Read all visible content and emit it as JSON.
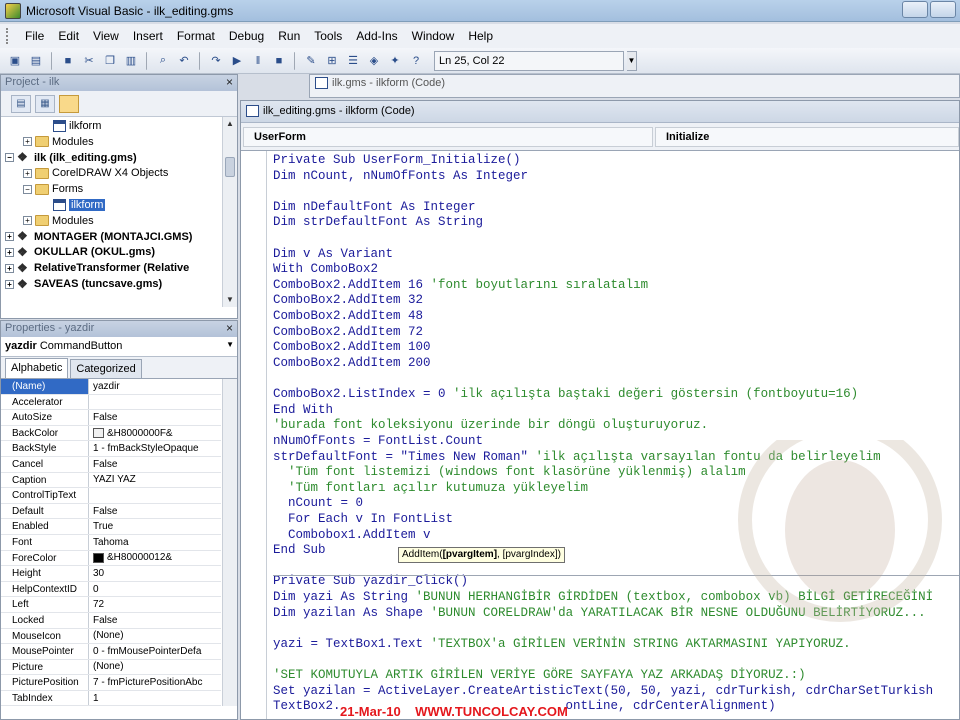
{
  "window": {
    "title": "Microsoft Visual Basic - ilk_editing.gms"
  },
  "menu": [
    "File",
    "Edit",
    "View",
    "Insert",
    "Format",
    "Debug",
    "Run",
    "Tools",
    "Add-Ins",
    "Window",
    "Help"
  ],
  "toolbar": {
    "buttons": [
      "view-host-icon",
      "insert-userform-icon",
      "save-icon",
      "cut-icon",
      "copy-icon",
      "paste-icon",
      "find-icon",
      "undo-icon",
      "redo-icon",
      "run-icon",
      "break-icon",
      "reset-icon",
      "design-mode-icon",
      "project-explorer-icon",
      "properties-window-icon",
      "object-browser-icon",
      "toolbox-icon",
      "help-icon"
    ],
    "position": "Ln 25, Col 22"
  },
  "project": {
    "title": "Project - ilk",
    "close": "×",
    "tree": [
      {
        "label": "ilkform",
        "icon": "form",
        "indent": 3,
        "bold": false,
        "expander": ""
      },
      {
        "label": "Modules",
        "icon": "folder",
        "indent": 2,
        "bold": false,
        "expander": "+"
      },
      {
        "label": "ilk (ilk_editing.gms)",
        "icon": "project",
        "indent": 1,
        "bold": true,
        "expander": "−"
      },
      {
        "label": "CorelDRAW X4 Objects",
        "icon": "folder",
        "indent": 2,
        "bold": false,
        "expander": "+"
      },
      {
        "label": "Forms",
        "icon": "folder",
        "indent": 2,
        "bold": false,
        "expander": "−"
      },
      {
        "label": "ilkform",
        "icon": "form",
        "indent": 3,
        "bold": false,
        "expander": "",
        "selected": true
      },
      {
        "label": "Modules",
        "icon": "folder",
        "indent": 2,
        "bold": false,
        "expander": "+"
      },
      {
        "label": "MONTAGER (MONTAJCI.GMS)",
        "icon": "project",
        "indent": 1,
        "bold": true,
        "expander": "+"
      },
      {
        "label": "OKULLAR (OKUL.gms)",
        "icon": "project",
        "indent": 1,
        "bold": true,
        "expander": "+"
      },
      {
        "label": "RelativeTransformer (Relative",
        "icon": "project",
        "indent": 1,
        "bold": true,
        "expander": "+"
      },
      {
        "label": "SAVEAS (tuncsave.gms)",
        "icon": "project",
        "indent": 1,
        "bold": true,
        "expander": "+"
      }
    ]
  },
  "properties": {
    "title": "Properties - yazdir",
    "close": "×",
    "object_name": "yazdir",
    "object_type": "CommandButton",
    "tabs": [
      "Alphabetic",
      "Categorized"
    ],
    "rows": [
      {
        "name": "(Name)",
        "value": "yazdir",
        "selected": true
      },
      {
        "name": "Accelerator",
        "value": ""
      },
      {
        "name": "AutoSize",
        "value": "False"
      },
      {
        "name": "BackColor",
        "value": "&H8000000F&",
        "swatch": "#f0f0f0"
      },
      {
        "name": "BackStyle",
        "value": "1 - fmBackStyleOpaque"
      },
      {
        "name": "Cancel",
        "value": "False"
      },
      {
        "name": "Caption",
        "value": "YAZI YAZ"
      },
      {
        "name": "ControlTipText",
        "value": ""
      },
      {
        "name": "Default",
        "value": "False"
      },
      {
        "name": "Enabled",
        "value": "True"
      },
      {
        "name": "Font",
        "value": "Tahoma"
      },
      {
        "name": "ForeColor",
        "value": "&H80000012&",
        "swatch": "#000000"
      },
      {
        "name": "Height",
        "value": "30"
      },
      {
        "name": "HelpContextID",
        "value": "0"
      },
      {
        "name": "Left",
        "value": "72"
      },
      {
        "name": "Locked",
        "value": "False"
      },
      {
        "name": "MouseIcon",
        "value": "(None)"
      },
      {
        "name": "MousePointer",
        "value": "0 - fmMousePointerDefa"
      },
      {
        "name": "Picture",
        "value": "(None)"
      },
      {
        "name": "PicturePosition",
        "value": "7 - fmPicturePositionAbc"
      },
      {
        "name": "TabIndex",
        "value": "1"
      }
    ]
  },
  "back_window": {
    "caption": "ilk.gms - ilkform (Code)"
  },
  "code_window": {
    "caption": "ilk_editing.gms - ilkform (Code)",
    "object_combo": "UserForm",
    "procedure_combo": "Initialize",
    "lines": [
      [
        [
          "kw",
          "Private Sub "
        ],
        [
          "tx",
          "UserForm_Initialize()"
        ]
      ],
      [
        [
          "kw",
          "Dim "
        ],
        [
          "tx",
          "nCount, nNumOfFonts "
        ],
        [
          "kw",
          "As Integer"
        ]
      ],
      [],
      [
        [
          "kw",
          "Dim "
        ],
        [
          "tx",
          "nDefaultFont "
        ],
        [
          "kw",
          "As Integer"
        ]
      ],
      [
        [
          "kw",
          "Dim "
        ],
        [
          "tx",
          "strDefaultFont "
        ],
        [
          "kw",
          "As String"
        ]
      ],
      [],
      [
        [
          "kw",
          "Dim "
        ],
        [
          "tx",
          "v "
        ],
        [
          "kw",
          "As Variant"
        ]
      ],
      [
        [
          "kw",
          "With "
        ],
        [
          "tx",
          "ComboBox2"
        ]
      ],
      [
        [
          "tx",
          "ComboBox2.AddItem 16 "
        ],
        [
          "cm",
          "'font boyutlarını sıralatalım"
        ]
      ],
      [
        [
          "tx",
          "ComboBox2.AddItem 32"
        ]
      ],
      [
        [
          "tx",
          "ComboBox2.AddItem 48"
        ]
      ],
      [
        [
          "tx",
          "ComboBox2.AddItem 72"
        ]
      ],
      [
        [
          "tx",
          "ComboBox2.AddItem 100"
        ]
      ],
      [
        [
          "tx",
          "ComboBox2.AddItem 200"
        ]
      ],
      [],
      [
        [
          "tx",
          "ComboBox2.ListIndex = 0 "
        ],
        [
          "cm",
          "'ilk açılışta baştaki değeri göstersin (fontboyutu=16)"
        ]
      ],
      [
        [
          "kw",
          "End With"
        ]
      ],
      [
        [
          "cm",
          "'burada font koleksiyonu üzerinde bir döngü oluşturuyoruz."
        ]
      ],
      [
        [
          "tx",
          "nNumOfFonts = FontList.Count"
        ]
      ],
      [
        [
          "tx",
          "strDefaultFont = \"Times New Roman\" "
        ],
        [
          "cm",
          "'ilk açılışta varsayılan fontu da belirleyelim"
        ]
      ],
      [
        [
          "cm",
          "  'Tüm font listemizi (windows font klasörüne yüklenmiş) alalım"
        ]
      ],
      [
        [
          "cm",
          "  'Tüm fontları açılır kutumuza yükleyelim"
        ]
      ],
      [
        [
          "tx",
          "  nCount = 0"
        ]
      ],
      [
        [
          "kw",
          "  For Each "
        ],
        [
          "tx",
          "v "
        ],
        [
          "kw",
          "In "
        ],
        [
          "tx",
          "FontList"
        ]
      ],
      [
        [
          "tx",
          "  Combobox1.AddItem v"
        ]
      ],
      [
        [
          "kw",
          "End Sub"
        ]
      ],
      [],
      [
        [
          "kw",
          "Private Sub "
        ],
        [
          "tx",
          "yazdir_Click()"
        ]
      ],
      [
        [
          "kw",
          "Dim "
        ],
        [
          "tx",
          "yazi "
        ],
        [
          "kw",
          "As String "
        ],
        [
          "cm",
          "'BUNUN HERHANGİBİR GİRDİDEN (textbox, combobox vb) BİLGİ GETİRECEĞİNİ"
        ]
      ],
      [
        [
          "kw",
          "Dim "
        ],
        [
          "tx",
          "yazilan "
        ],
        [
          "kw",
          "As Shape "
        ],
        [
          "cm",
          "'BUNUN CORELDRAW'da YARATILACAK BİR NESNE OLDUĞUNU BELİRTİYORUZ..."
        ]
      ],
      [],
      [
        [
          "tx",
          "yazi = TextBox1.Text "
        ],
        [
          "cm",
          "'TEXTBOX'a GİRİLEN VERİNİN STRING AKTARMASINI YAPIYORUZ."
        ]
      ],
      [],
      [
        [
          "cm",
          "'SET KOMUTUYLA ARTIK GİRİLEN VERİYE GÖRE SAYFAYA YAZ ARKADAŞ DİYORUZ.:)"
        ]
      ],
      [
        [
          "kw",
          "Set "
        ],
        [
          "tx",
          "yazilan = ActiveLayer.CreateArtisticText(50, 50, yazi, cdrTurkish, cdrCharSetTurkish"
        ]
      ],
      [
        [
          "tx",
          "TextBox2.                              ontLine, cdrCenterAlignment)"
        ]
      ]
    ],
    "tooltip": {
      "func": "AddItem(",
      "arg1": "[pvargItem]",
      "rest": ", [pvargIndex])"
    }
  },
  "watermark": {
    "date": "21-Mar-10",
    "site": "WWW.TUNCOLCAY.COM"
  }
}
